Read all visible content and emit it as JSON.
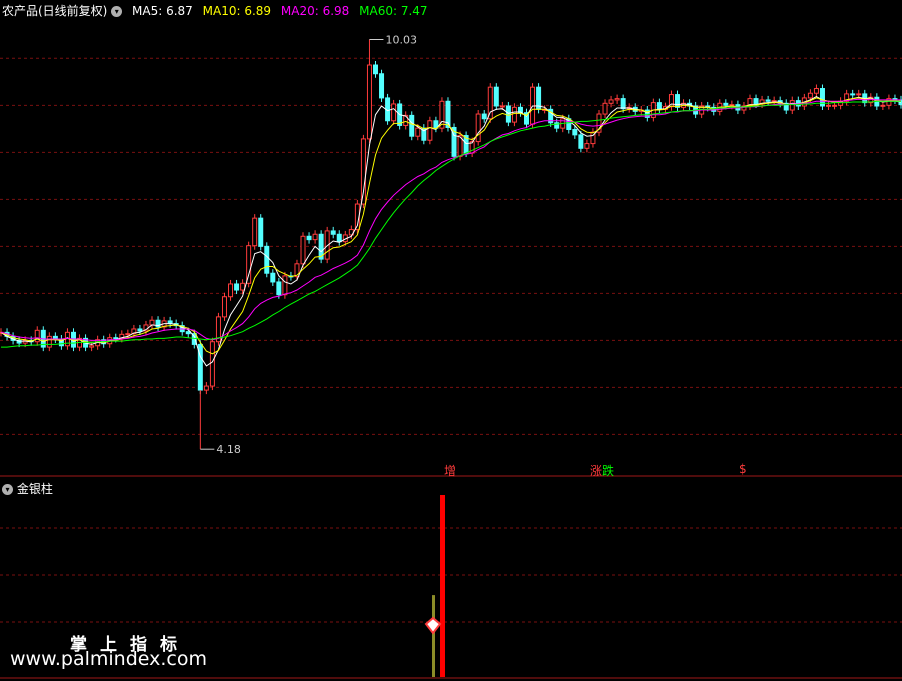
{
  "header": {
    "title": "农产品(日线前复权)",
    "ma5": "MA5: 6.87",
    "ma10": "MA10: 6.89",
    "ma20": "MA20: 6.98",
    "ma60": "MA60: 7.47"
  },
  "indicator": {
    "name": "金银柱"
  },
  "signals": {
    "s1": "增",
    "s2_a": "涨",
    "s2_b": "跌",
    "s3": "$"
  },
  "watermark": {
    "line1": "掌上指标",
    "line2": "www.palmindex.com"
  },
  "colors": {
    "up": "#ff3c3c",
    "down": "#54ffff",
    "ma5": "#ffffff",
    "ma10": "#ffff00",
    "ma20": "#ff00ff",
    "ma60": "#00ff00",
    "grid": "#7a1010",
    "bar_red": "#ff0000",
    "bar_olive": "#8c8c28"
  },
  "chart_data": {
    "type": "candlestick",
    "ylim": [
      3.9,
      10.6
    ],
    "gridlines": [
      4.4,
      5.1,
      5.8,
      6.5,
      7.2,
      7.9,
      8.6,
      9.3,
      10.0
    ],
    "annotations": [
      {
        "text": "10.03",
        "value": 10.28
      },
      {
        "text": "4.18",
        "value": 4.18
      }
    ],
    "sample_interval": 6,
    "close": [
      5.92,
      5.86,
      5.8,
      5.76,
      5.8,
      5.78,
      5.95,
      5.7,
      5.86,
      5.82,
      5.72,
      5.92,
      5.7,
      5.83,
      5.7,
      5.72,
      5.81,
      5.75,
      5.84,
      5.83,
      5.89,
      5.9,
      5.97,
      5.94,
      6.03,
      6.1,
      6.0,
      6.09,
      6.05,
      6.02,
      5.93,
      5.9,
      5.74,
      5.06,
      5.12,
      5.78,
      6.15,
      6.45,
      6.64,
      6.55,
      6.65,
      7.21,
      7.62,
      7.2,
      6.8,
      6.67,
      6.48,
      6.76,
      6.75,
      6.94,
      7.35,
      7.3,
      7.38,
      7.01,
      7.43,
      7.38,
      7.27,
      7.37,
      7.45,
      7.83,
      8.8,
      9.9,
      9.77,
      9.41,
      9.07,
      9.32,
      9.0,
      9.15,
      8.84,
      8.96,
      8.78,
      9.07,
      8.96,
      9.36,
      8.97,
      8.54,
      8.85,
      8.59,
      8.76,
      9.17,
      9.1,
      9.57,
      9.29,
      9.29,
      9.05,
      9.27,
      9.19,
      9.02,
      9.57,
      9.24,
      9.24,
      9.04,
      8.96,
      9.1,
      8.94,
      8.86,
      8.66,
      8.73,
      8.9,
      9.17,
      9.33,
      9.38,
      9.4,
      9.25,
      9.27,
      9.21,
      9.23,
      9.12,
      9.34,
      9.24,
      9.28,
      9.46,
      9.27,
      9.33,
      9.29,
      9.17,
      9.29,
      9.27,
      9.21,
      9.33,
      9.3,
      9.31,
      9.23,
      9.29,
      9.4,
      9.32,
      9.38,
      9.36,
      9.37,
      9.33,
      9.23,
      9.37,
      9.29,
      9.41,
      9.48,
      9.55,
      9.29,
      9.3,
      9.3,
      9.36,
      9.47,
      9.46,
      9.47,
      9.34,
      9.42,
      9.29,
      9.3,
      9.4,
      9.38,
      9.31
    ],
    "ma5": [
      5.92,
      5.86,
      5.82,
      5.79,
      5.79,
      5.78,
      5.83,
      5.78,
      5.82,
      5.82,
      5.79,
      5.84,
      5.79,
      5.81,
      5.76,
      5.74,
      5.77,
      5.76,
      5.8,
      5.81,
      5.84,
      5.86,
      5.91,
      5.92,
      5.96,
      6.03,
      6.02,
      6.05,
      6.05,
      6.04,
      5.99,
      5.96,
      5.86,
      5.56,
      5.42,
      5.48,
      5.66,
      5.96,
      6.18,
      6.32,
      6.46,
      6.78,
      7.09,
      7.12,
      7.05,
      6.96,
      6.76,
      6.67,
      6.64,
      6.7,
      6.92,
      7.07,
      7.2,
      7.12,
      7.21,
      7.28,
      7.26,
      7.31,
      7.35,
      7.51,
      8.01,
      8.71,
      9.16,
      9.29,
      9.22,
      9.25,
      9.16,
      9.14,
      9.04,
      8.98,
      8.92,
      8.97,
      8.94,
      9.06,
      9.04,
      8.85,
      8.83,
      8.73,
      8.74,
      8.89,
      8.99,
      9.2,
      9.24,
      9.25,
      9.18,
      9.2,
      9.2,
      9.14,
      9.29,
      9.29,
      9.27,
      9.19,
      9.12,
      9.12,
      9.07,
      9.0,
      8.89,
      8.84,
      8.85,
      8.95,
      9.08,
      9.19,
      9.26,
      9.26,
      9.26,
      9.24,
      9.23,
      9.19,
      9.23,
      9.24,
      9.25,
      9.32,
      9.31,
      9.32,
      9.31,
      9.27,
      9.27,
      9.27,
      9.25,
      9.27,
      9.28,
      9.29,
      9.27,
      9.28,
      9.31,
      9.31,
      9.33,
      9.34,
      9.35,
      9.35,
      9.31,
      9.33,
      9.32,
      9.35,
      9.38,
      9.43,
      9.38,
      9.36,
      9.35,
      9.35,
      9.38,
      9.4,
      9.42,
      9.4,
      9.41,
      9.37,
      9.35,
      9.36,
      9.36,
      9.35
    ],
    "ma10": [
      5.92,
      5.88,
      5.84,
      5.82,
      5.81,
      5.79,
      5.82,
      5.79,
      5.81,
      5.81,
      5.8,
      5.83,
      5.8,
      5.81,
      5.78,
      5.77,
      5.78,
      5.77,
      5.79,
      5.8,
      5.82,
      5.84,
      5.87,
      5.89,
      5.92,
      5.97,
      5.98,
      6.01,
      6.02,
      6.03,
      6.01,
      5.98,
      5.93,
      5.77,
      5.64,
      5.6,
      5.65,
      5.8,
      5.97,
      6.1,
      6.23,
      6.47,
      6.73,
      6.86,
      6.9,
      6.9,
      6.83,
      6.79,
      6.75,
      6.77,
      6.86,
      6.94,
      7.04,
      7.05,
      7.12,
      7.18,
      7.19,
      7.23,
      7.27,
      7.37,
      7.68,
      8.14,
      8.56,
      8.81,
      8.93,
      9.03,
      9.03,
      9.06,
      9.02,
      9.0,
      8.95,
      8.97,
      8.95,
      9.02,
      9.01,
      8.91,
      8.88,
      8.81,
      8.79,
      8.86,
      8.93,
      9.08,
      9.14,
      9.18,
      9.15,
      9.18,
      9.18,
      9.15,
      9.24,
      9.24,
      9.24,
      9.2,
      9.15,
      9.14,
      9.1,
      9.04,
      8.95,
      8.9,
      8.89,
      8.94,
      9.04,
      9.13,
      9.2,
      9.22,
      9.24,
      9.23,
      9.23,
      9.2,
      9.23,
      9.23,
      9.24,
      9.29,
      9.28,
      9.3,
      9.29,
      9.27,
      9.27,
      9.27,
      9.25,
      9.27,
      9.28,
      9.29,
      9.27,
      9.28,
      9.3,
      9.3,
      9.32,
      9.33,
      9.34,
      9.34,
      9.31,
      9.32,
      9.32,
      9.34,
      9.37,
      9.41,
      9.38,
      9.36,
      9.35,
      9.35,
      9.38,
      9.4,
      9.41,
      9.39,
      9.4,
      9.37,
      9.36,
      9.37,
      9.37,
      9.36
    ],
    "ma20": [
      5.92,
      5.9,
      5.87,
      5.85,
      5.84,
      5.83,
      5.84,
      5.82,
      5.82,
      5.82,
      5.82,
      5.83,
      5.82,
      5.82,
      5.81,
      5.8,
      5.8,
      5.8,
      5.81,
      5.81,
      5.82,
      5.83,
      5.85,
      5.86,
      5.88,
      5.91,
      5.93,
      5.95,
      5.96,
      5.97,
      5.97,
      5.97,
      5.95,
      5.89,
      5.83,
      5.81,
      5.83,
      5.88,
      5.94,
      5.99,
      6.05,
      6.15,
      6.27,
      6.35,
      6.4,
      6.44,
      6.46,
      6.49,
      6.51,
      6.55,
      6.61,
      6.67,
      6.74,
      6.77,
      6.82,
      6.87,
      6.91,
      6.95,
      7.0,
      7.07,
      7.22,
      7.43,
      7.61,
      7.75,
      7.86,
      7.96,
      8.04,
      8.12,
      8.18,
      8.24,
      8.28,
      8.34,
      8.38,
      8.45,
      8.49,
      8.52,
      8.55,
      8.57,
      8.59,
      8.64,
      8.68,
      8.76,
      8.81,
      8.86,
      8.88,
      8.92,
      8.95,
      8.97,
      9.02,
      9.05,
      9.07,
      9.07,
      9.07,
      9.07,
      9.06,
      9.05,
      9.02,
      9.0,
      8.99,
      9.0,
      9.02,
      9.05,
      9.08,
      9.1,
      9.12,
      9.13,
      9.14,
      9.14,
      9.16,
      9.16,
      9.17,
      9.2,
      9.2,
      9.22,
      9.22,
      9.22,
      9.23,
      9.23,
      9.23,
      9.24,
      9.25,
      9.26,
      9.26,
      9.27,
      9.28,
      9.28,
      9.29,
      9.3,
      9.31,
      9.32,
      9.31,
      9.32,
      9.32,
      9.33,
      9.34,
      9.36,
      9.36,
      9.36,
      9.36,
      9.36,
      9.37,
      9.38,
      9.39,
      9.38,
      9.39,
      9.38,
      9.38,
      9.38,
      9.38,
      9.38
    ],
    "ma60": [
      5.7,
      5.7,
      5.71,
      5.72,
      5.72,
      5.73,
      5.73,
      5.74,
      5.74,
      5.74,
      5.75,
      5.76,
      5.76,
      5.77,
      5.77,
      5.77,
      5.78,
      5.78,
      5.79,
      5.79,
      5.79,
      5.8,
      5.81,
      5.81,
      5.82,
      5.82,
      5.83,
      5.83,
      5.84,
      5.85,
      5.85,
      5.84,
      5.83,
      5.82,
      5.81,
      5.82,
      5.84,
      5.85,
      5.87,
      5.9,
      5.93,
      5.98,
      6.02,
      6.07,
      6.12,
      6.18,
      6.23,
      6.29,
      6.34,
      6.39,
      6.44,
      6.49,
      6.53,
      6.58,
      6.63,
      6.68,
      6.73,
      6.79,
      6.85,
      6.92,
      7.04,
      7.17,
      7.32,
      7.45,
      7.58,
      7.7,
      7.81,
      7.91,
      8.0,
      8.1,
      8.18,
      8.25,
      8.33,
      8.39,
      8.45,
      8.5,
      8.55,
      8.59,
      8.63,
      8.67,
      8.71,
      8.76,
      8.8,
      8.83,
      8.86,
      8.89,
      8.92,
      8.94,
      8.96,
      8.98,
      8.99,
      9.01,
      9.02,
      9.03,
      9.04,
      9.05,
      9.06,
      9.06,
      9.07,
      9.08,
      9.09,
      9.11,
      9.12,
      9.13,
      9.14,
      9.15,
      9.16,
      9.16,
      9.17,
      9.18,
      9.19,
      9.2,
      9.21,
      9.22,
      9.22,
      9.23,
      9.24,
      9.24,
      9.25,
      9.26,
      9.26,
      9.27,
      9.27,
      9.28,
      9.28,
      9.29,
      9.29,
      9.3,
      9.3,
      9.3,
      9.31,
      9.31,
      9.31,
      9.32,
      9.32,
      9.33,
      9.33,
      9.33,
      9.34,
      9.34,
      9.34,
      9.35,
      9.35,
      9.35,
      9.35,
      9.36,
      9.36,
      9.36,
      9.36,
      9.36
    ],
    "indicator_bars": [
      {
        "type": "bar",
        "color": "red",
        "height_pct": 100
      },
      {
        "type": "bar",
        "color": "olive",
        "height_pct": 45
      }
    ]
  }
}
